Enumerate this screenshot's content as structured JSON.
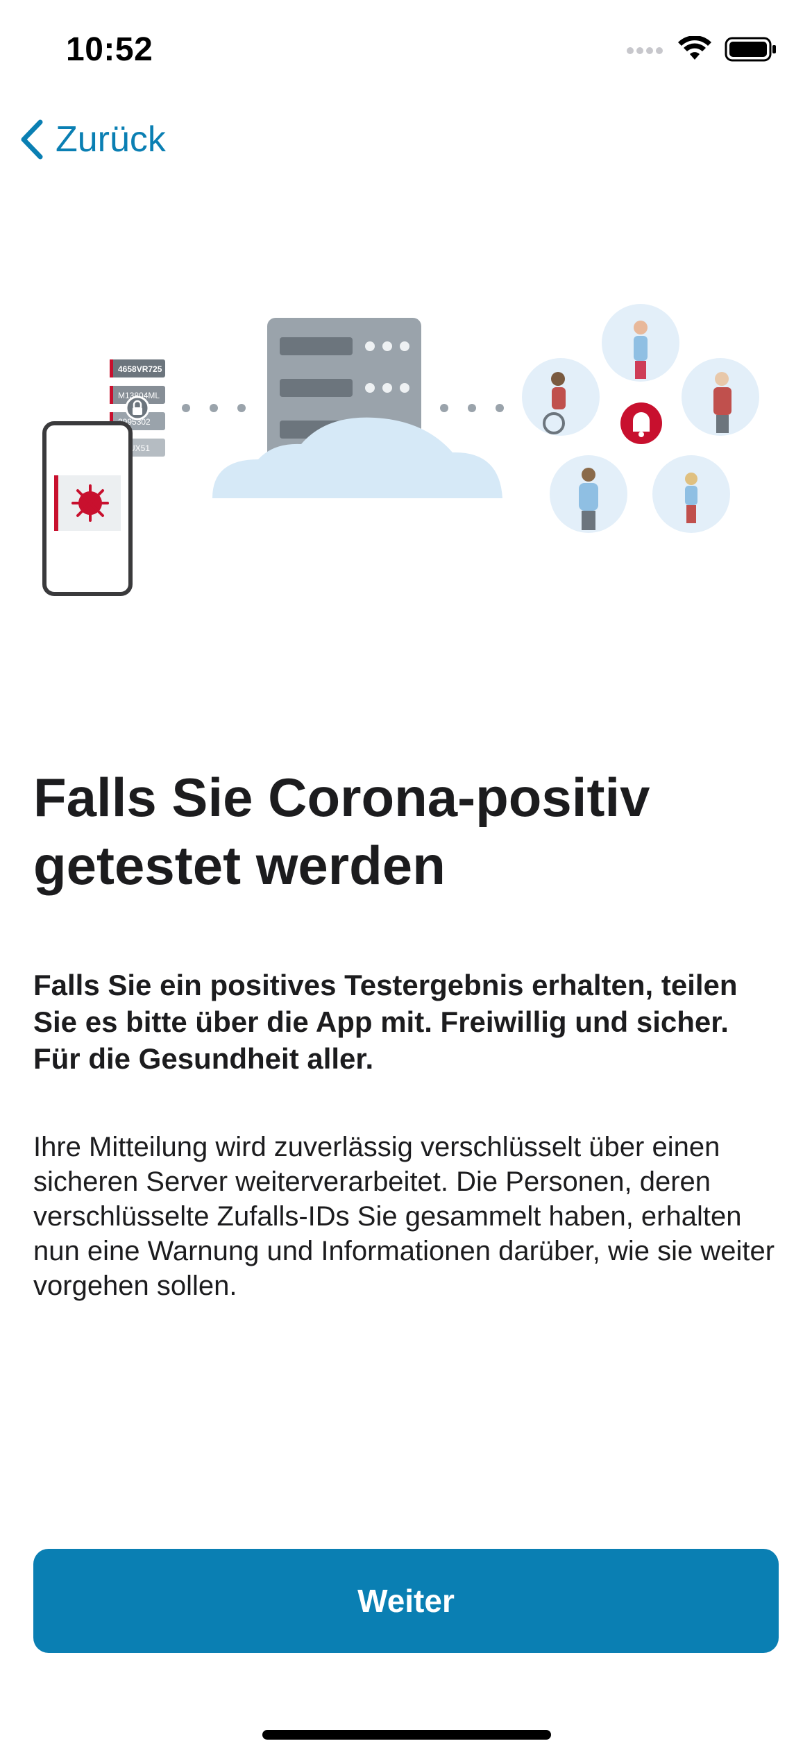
{
  "status_bar": {
    "time": "10:52",
    "icons": [
      "signal-icon",
      "wifi-icon",
      "battery-icon"
    ]
  },
  "nav": {
    "back_label": "Zurück",
    "back_icon": "chevron-left-icon"
  },
  "illustration": {
    "id_codes": [
      "4658VR725",
      "M13804ML",
      "2995302",
      "8GUX51"
    ],
    "icons": [
      "virus-icon",
      "lock-icon",
      "bell-icon",
      "cloud-server",
      "people-group"
    ]
  },
  "content": {
    "title_line1": "Falls Sie Corona-positiv",
    "title_line2": "getestet werden",
    "lead_text": "Falls Sie ein positives Testergebnis erhalten, teilen Sie es bitte über die App mit. Freiwillig und sicher. Für die Gesundheit aller.",
    "body_text": "Ihre Mitteilung wird zuverlässig verschlüsselt über einen sicheren Server weiterverarbeitet. Die Personen, deren verschlüsselte Zufalls-IDs Sie gesammelt haben, erhalten nun eine Warnung und Informationen darüber, wie sie weiter vorgehen sollen."
  },
  "actions": {
    "continue_label": "Weiter"
  },
  "colors": {
    "accent": "#0a7fb3",
    "alert_red": "#c8102e",
    "server_gray": "#9aa3ab",
    "cloud_blue": "#d6e9f7"
  }
}
